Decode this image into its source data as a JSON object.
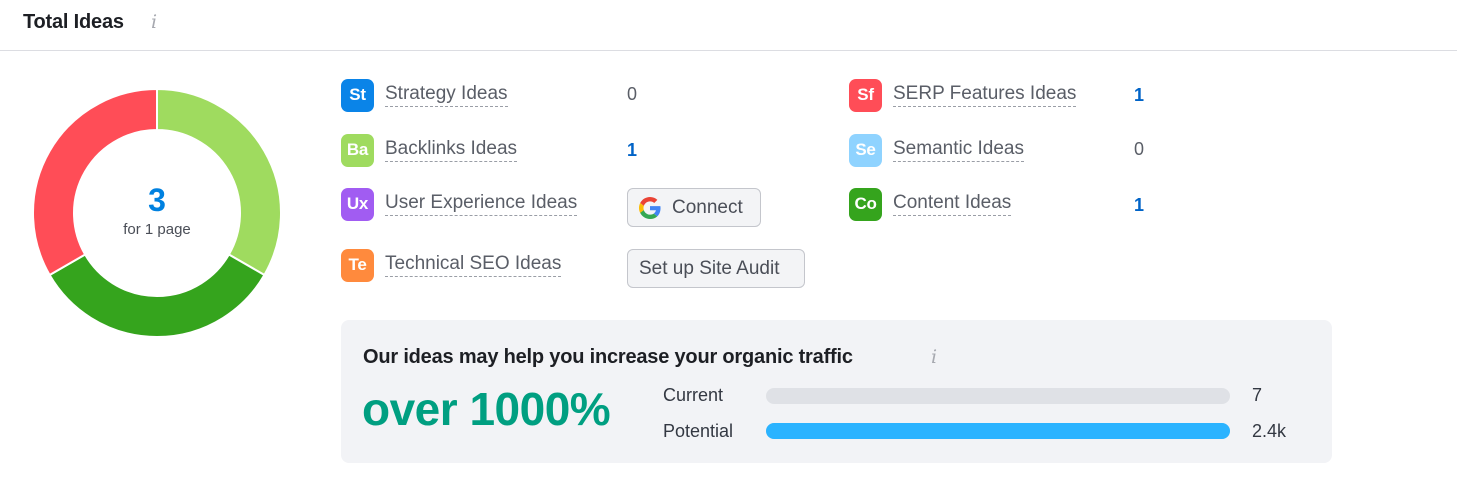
{
  "header": {
    "title": "Total Ideas"
  },
  "donut": {
    "total": "3",
    "subtitle": "for 1 page",
    "segments": [
      {
        "name": "Backlinks Ideas",
        "value": 1,
        "color": "#9fdb5f"
      },
      {
        "name": "Content Ideas",
        "value": 1,
        "color": "#35a41d"
      },
      {
        "name": "SERP Features Ideas",
        "value": 1,
        "color": "#ff4d57"
      }
    ]
  },
  "ideas": {
    "strategy": {
      "badge": "St",
      "label": "Strategy Ideas",
      "count": "0",
      "color": "#0a84e8"
    },
    "backlinks": {
      "badge": "Ba",
      "label": "Backlinks Ideas",
      "count": "1",
      "color": "#9fdb5f"
    },
    "user_experience": {
      "badge": "Ux",
      "label": "User Experience Ideas",
      "action": "Connect",
      "icon": "google-icon",
      "color": "#a15cf2"
    },
    "technical_seo": {
      "badge": "Te",
      "label": "Technical SEO Ideas",
      "action": "Set up Site Audit",
      "color": "#ff8a3d"
    },
    "serp_features": {
      "badge": "Sf",
      "label": "SERP Features Ideas",
      "count": "1",
      "color": "#ff4d57"
    },
    "semantic": {
      "badge": "Se",
      "label": "Semantic Ideas",
      "count": "0",
      "color": "#8fd3ff"
    },
    "content": {
      "badge": "Co",
      "label": "Content Ideas",
      "count": "1",
      "color": "#35a41d"
    }
  },
  "traffic": {
    "title": "Our ideas may help you increase your organic traffic",
    "increase": "over 1000%",
    "current": {
      "label": "Current",
      "value": "7",
      "fill": 0
    },
    "potential": {
      "label": "Potential",
      "value": "2.4k",
      "fill": 1
    }
  }
}
